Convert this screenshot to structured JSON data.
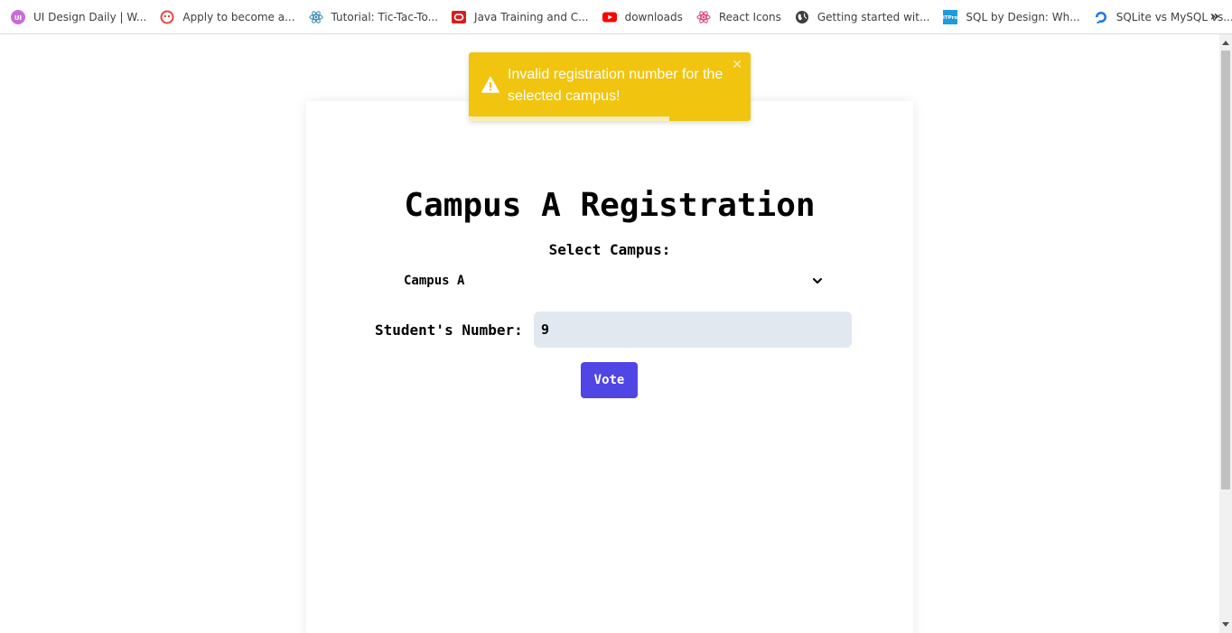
{
  "bookmarks": {
    "items": [
      {
        "label": "UI Design Daily | W...",
        "icon": "ui-design-daily-icon"
      },
      {
        "label": "Apply to become a...",
        "icon": "apply-icon"
      },
      {
        "label": "Tutorial: Tic-Tac-To...",
        "icon": "react-atom-icon"
      },
      {
        "label": "Java Training and C...",
        "icon": "oracle-icon"
      },
      {
        "label": "downloads",
        "icon": "youtube-icon"
      },
      {
        "label": "React Icons",
        "icon": "react-icons-icon"
      },
      {
        "label": "Getting started wit...",
        "icon": "globe-icon"
      },
      {
        "label": "SQL by Design: Wh...",
        "icon": "itpro-icon"
      },
      {
        "label": "SQLite vs MySQL vs...",
        "icon": "digitalocean-icon"
      }
    ],
    "overflow_label": "»"
  },
  "form": {
    "title": "Campus A Registration",
    "campus_label": "Select Campus:",
    "campus_selected": "Campus A",
    "student_number_label": "Student's Number:",
    "student_number_value": "9",
    "vote_label": "Vote"
  },
  "toast": {
    "message": "Invalid registration number for the selected campus!",
    "close_symbol": "✕",
    "type": "warning",
    "progress": 0.71
  },
  "colors": {
    "toast_bg": "#f1c40f",
    "vote_button": "#4f46e5",
    "input_bg": "#e2e8f0"
  }
}
